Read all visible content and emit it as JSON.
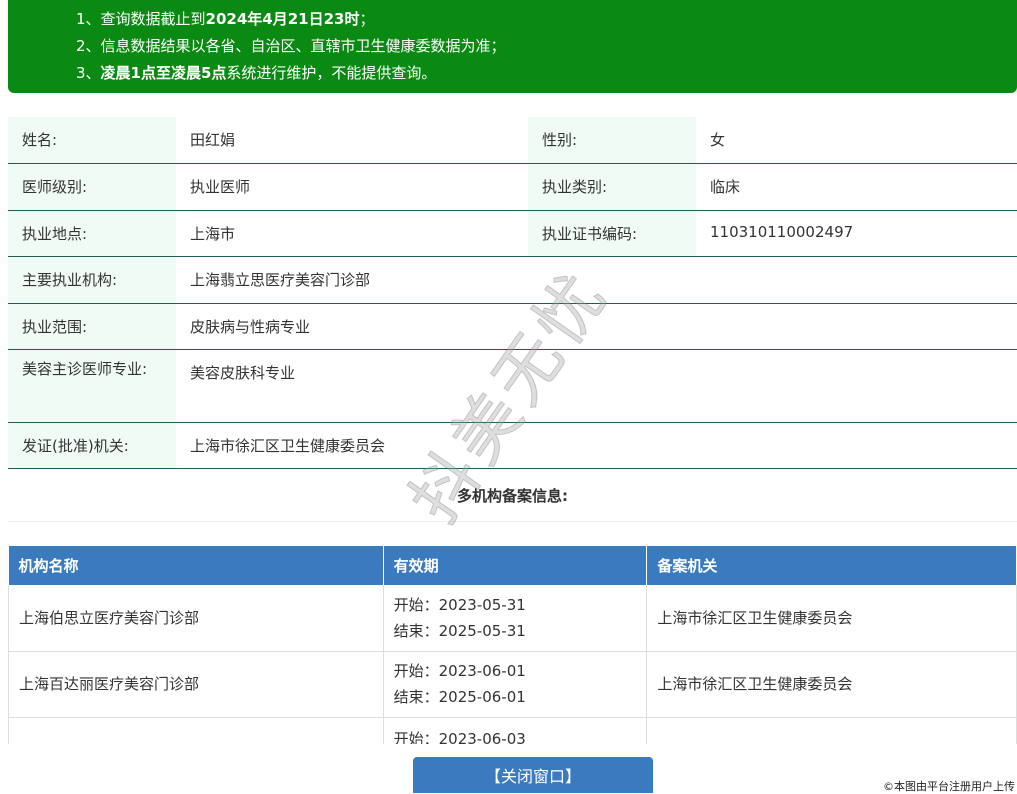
{
  "notice": {
    "line1_prefix": "1、查询数据截止到",
    "line1_bold": "2024年4月21日23时",
    "line1_suffix": "；",
    "line2": "2、信息数据结果以各省、自治区、直辖市卫生健康委数据为准；",
    "line3_prefix": "3、",
    "line3_bold": "凌晨1点至凌晨5点",
    "line3_suffix": "系统进行维护，不能提供查询。"
  },
  "info": {
    "name_label": "姓名:",
    "name_value": "田红娟",
    "gender_label": "性别:",
    "gender_value": "女",
    "level_label": "医师级别:",
    "level_value": "执业医师",
    "category_label": "执业类别:",
    "category_value": "临床",
    "location_label": "执业地点:",
    "location_value": "上海市",
    "cert_label": "执业证书编码:",
    "cert_value": "110310110002497",
    "institution_label": "主要执业机构:",
    "institution_value": "上海翡立思医疗美容门诊部",
    "scope_label": "执业范围:",
    "scope_value": "皮肤病与性病专业",
    "cosmetic_label": "美容主诊医师专业:",
    "cosmetic_value": "美容皮肤科专业",
    "issuer_label": "发证(批准)机关:",
    "issuer_value": "上海市徐汇区卫生健康委员会"
  },
  "multi_title": "多机构备案信息:",
  "records": {
    "headers": [
      "机构名称",
      "有效期",
      "备案机关"
    ],
    "rows": [
      {
        "name": "上海伯思立医疗美容门诊部",
        "start": "开始：2023-05-31",
        "end": "结束：2025-05-31",
        "authority": "上海市徐汇区卫生健康委员会"
      },
      {
        "name": "上海百达丽医疗美容门诊部",
        "start": "开始：2023-06-01",
        "end": "结束：2025-06-01",
        "authority": "上海市徐汇区卫生健康委员会"
      },
      {
        "name": "",
        "start": "开始：2023-06-03",
        "end": "",
        "authority": ""
      }
    ]
  },
  "watermark": "抖美无忧",
  "close_button": "【关闭窗口】",
  "copyright": "©本图由平台注册用户上传",
  "colors": {
    "notice_bg": "#0a8a12",
    "header_bg": "#3a7bbf",
    "label_bg": "#f1fbf5"
  }
}
